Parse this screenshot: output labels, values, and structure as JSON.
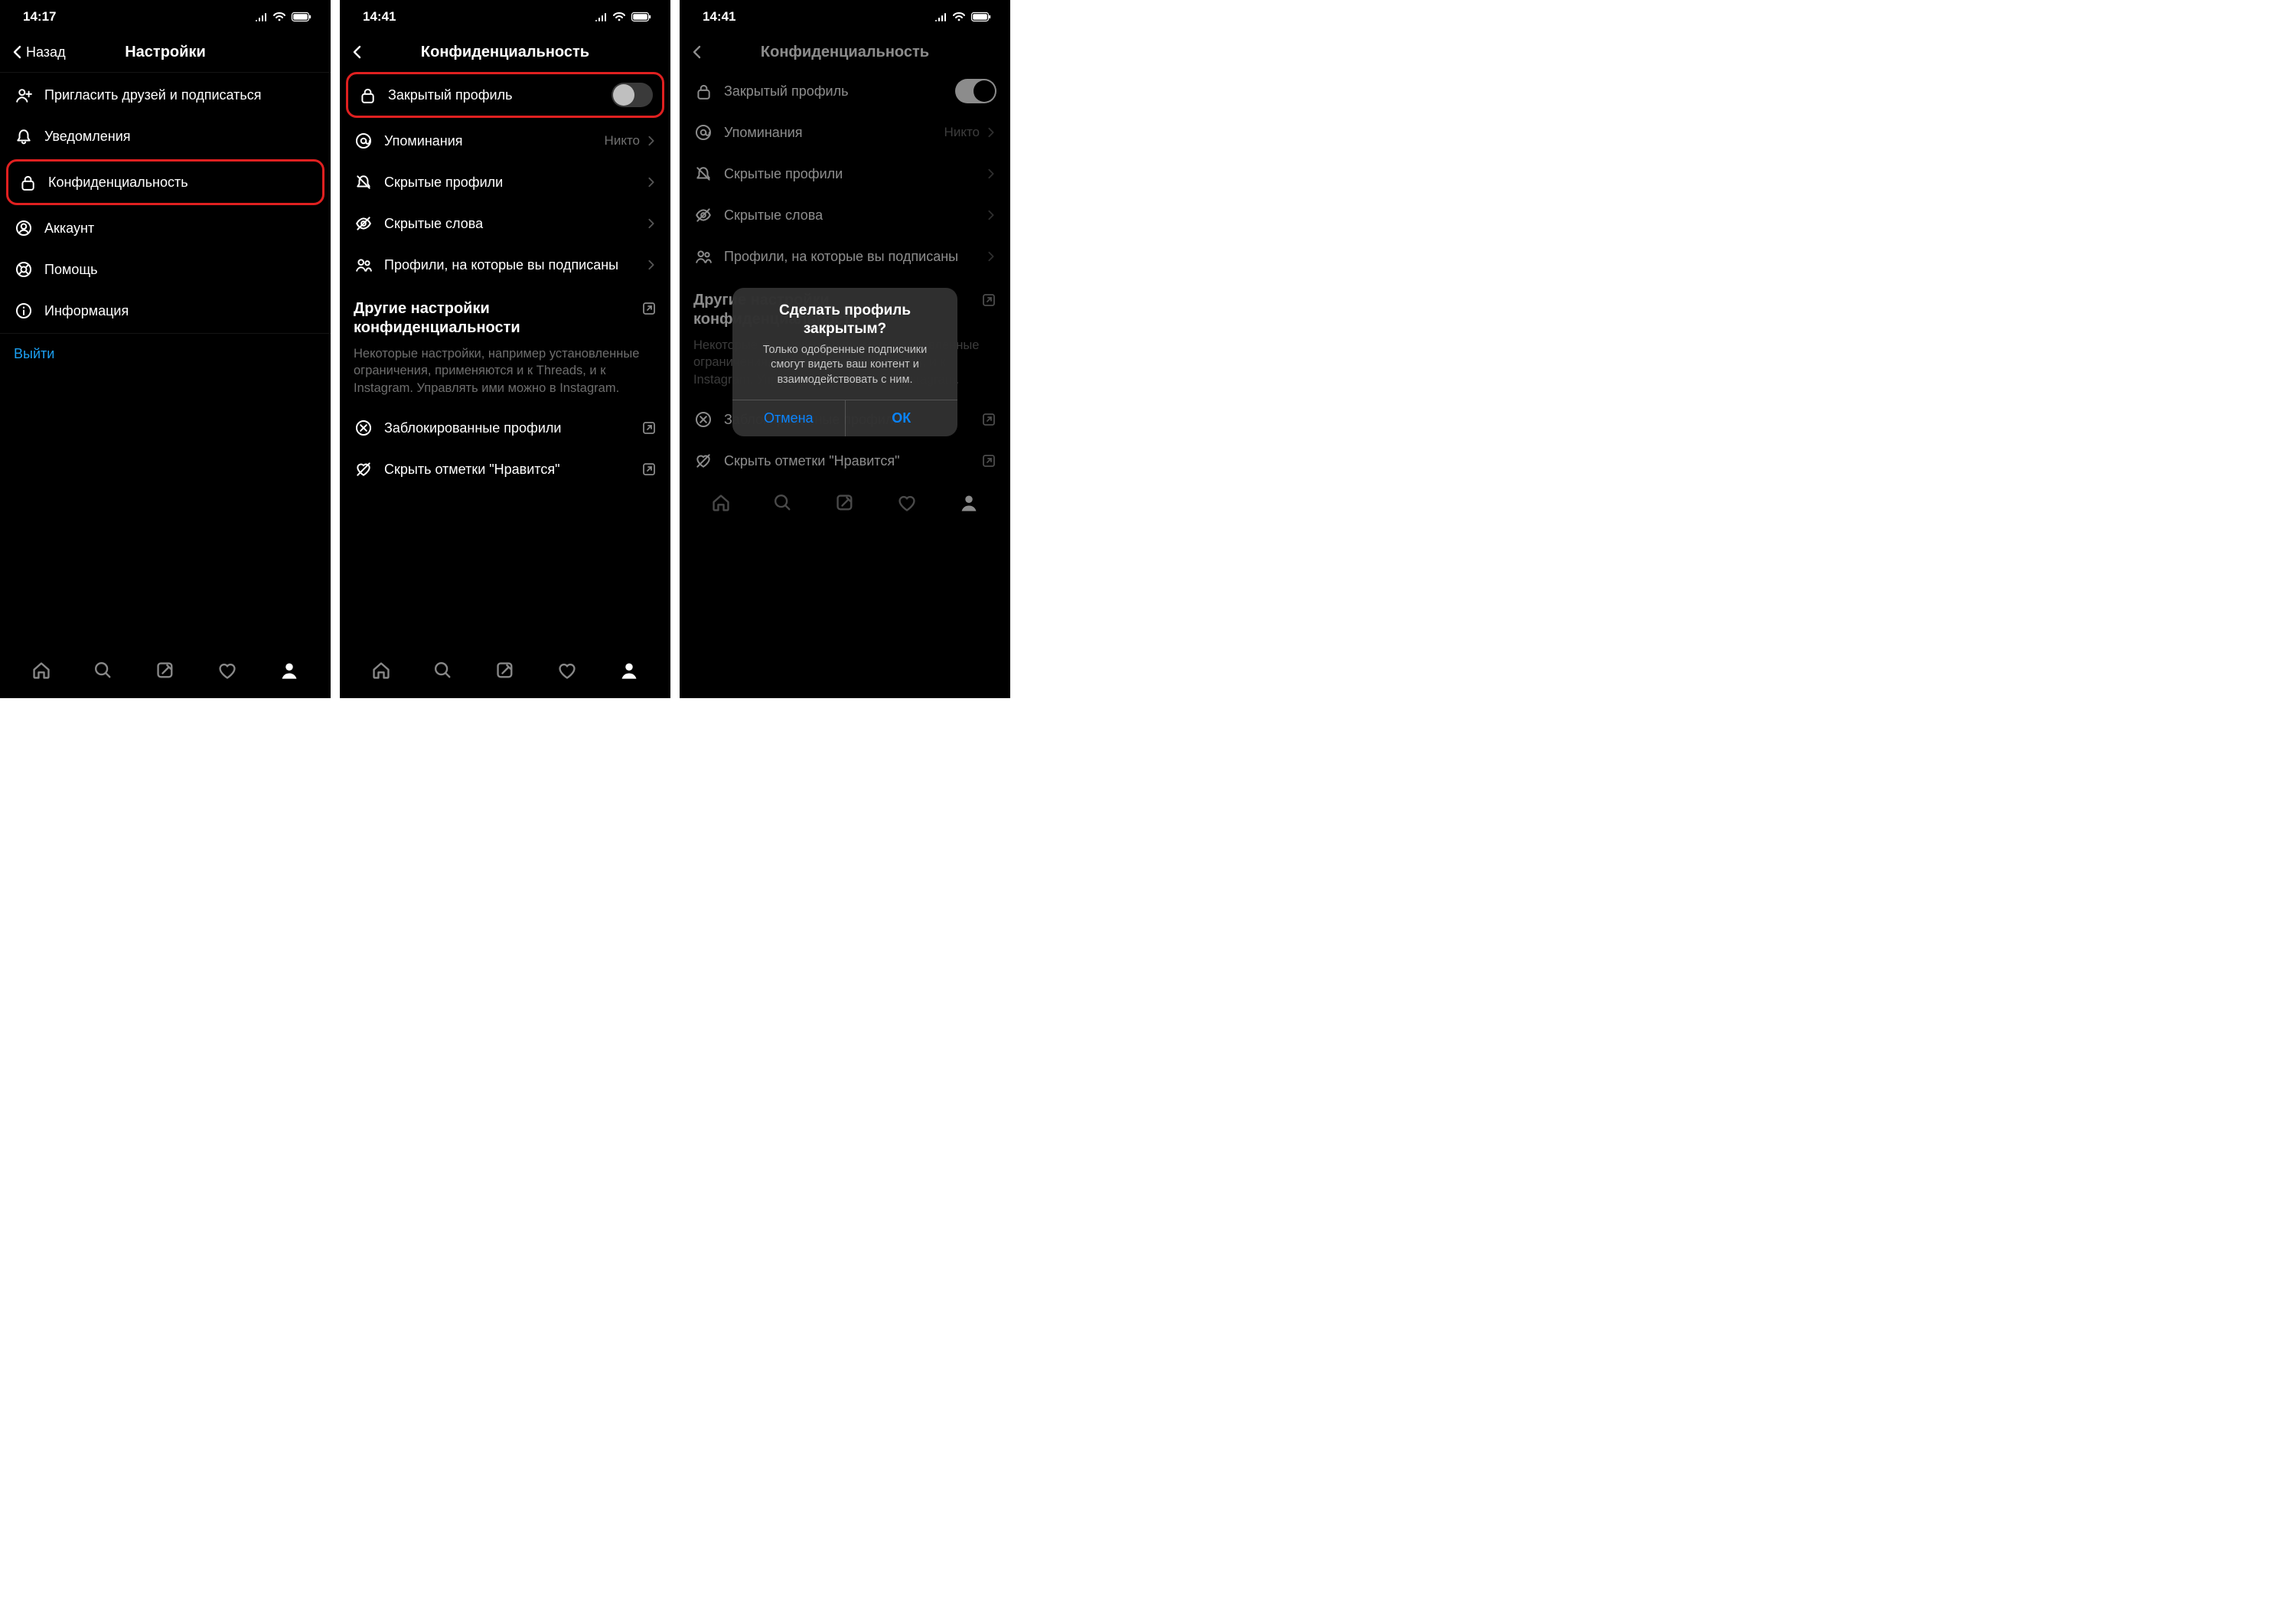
{
  "statusbar": {
    "time1": "14:17",
    "time2": "14:41",
    "time3": "14:41"
  },
  "s1": {
    "back": "Назад",
    "title": "Настройки",
    "items": [
      {
        "label": "Пригласить друзей и подписаться"
      },
      {
        "label": "Уведомления"
      },
      {
        "label": "Конфиденциальность"
      },
      {
        "label": "Аккаунт"
      },
      {
        "label": "Помощь"
      },
      {
        "label": "Информация"
      }
    ],
    "logout": "Выйти"
  },
  "s2": {
    "title": "Конфиденциальность",
    "items": [
      {
        "label": "Закрытый профиль"
      },
      {
        "label": "Упоминания",
        "value": "Никто"
      },
      {
        "label": "Скрытые профили"
      },
      {
        "label": "Скрытые слова"
      },
      {
        "label": "Профили, на которые вы подписаны"
      }
    ],
    "sectionTitle": "Другие настройки конфиденциальности",
    "sectionDesc": "Некоторые настройки, например установленные ограничения, применяются и к Threads, и к Instagram. Управлять ими можно в Instagram.",
    "extra": [
      {
        "label": "Заблокированные профили"
      },
      {
        "label": "Скрыть отметки \"Нравится\""
      }
    ]
  },
  "s3": {
    "title": "Конфиденциальность",
    "dialog": {
      "title": "Сделать профиль закрытым?",
      "body": "Только одобренные подписчики смогут видеть ваш контент и взаимодействовать с ним.",
      "cancel": "Отмена",
      "ok": "ОК"
    }
  }
}
